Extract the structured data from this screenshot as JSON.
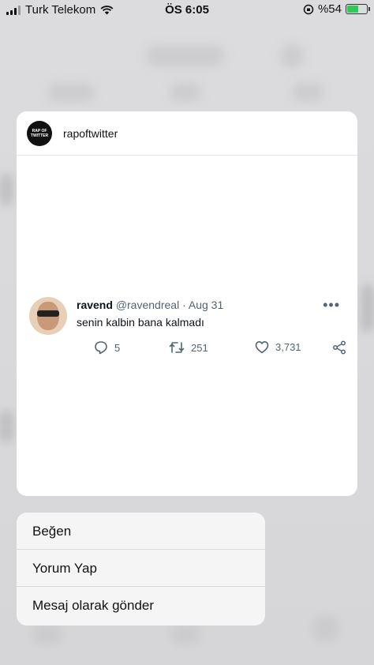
{
  "status_bar": {
    "carrier": "Turk Telekom",
    "time": "ÖS 6:05",
    "battery": "%54",
    "battery_level": 0.54
  },
  "card": {
    "account": "rapoftwitter",
    "logo_text": [
      "RAP OF",
      "TWITTER"
    ]
  },
  "tweet": {
    "name": "ravend",
    "handle": "@ravendreal",
    "separator": "·",
    "date": "Aug 31",
    "text": "senin kalbin bana kalmadı",
    "replies": "5",
    "retweets": "251",
    "likes": "3,731"
  },
  "menu": {
    "items": [
      {
        "label": "Beğen"
      },
      {
        "label": "Yorum Yap"
      },
      {
        "label": "Mesaj olarak gönder"
      }
    ]
  },
  "colors": {
    "like_battery": "#34c759",
    "muted_text": "#536471"
  }
}
